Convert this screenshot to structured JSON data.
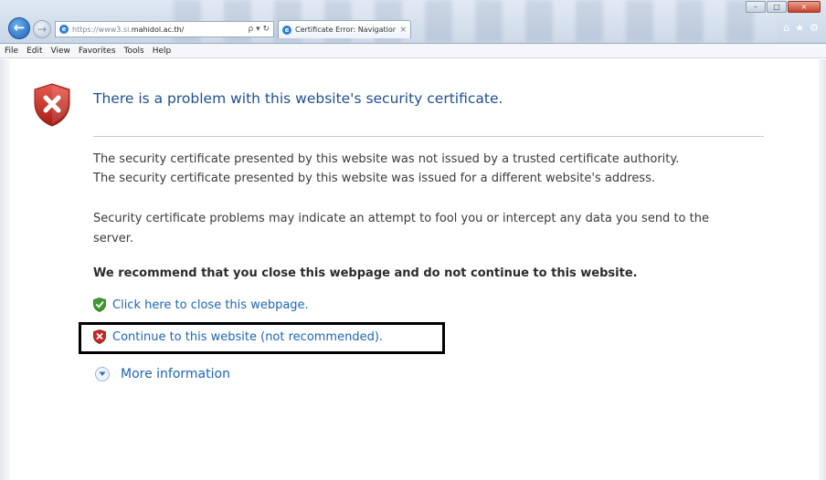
{
  "browser": {
    "address": {
      "url_prefix": "https://www3.si.",
      "url_domain": "mahidol.ac.th/",
      "tools": "ρ ▾ ↻"
    },
    "tab": {
      "title": "Certificate Error: Navigation...",
      "close": "×"
    },
    "window_buttons": {
      "minimize": "–",
      "maximize": "□",
      "close": "×"
    },
    "toolbar_icons": {
      "home": "⌂",
      "favorites": "★",
      "settings": "⚙"
    },
    "menu": [
      "File",
      "Edit",
      "View",
      "Favorites",
      "Tools",
      "Help"
    ]
  },
  "page": {
    "headline": "There is a problem with this website's security certificate.",
    "para1": "The security certificate presented by this website was not issued by a trusted certificate authority.",
    "para2": "The security certificate presented by this website was issued for a different website's address.",
    "para3": "Security certificate problems may indicate an attempt to fool you or intercept any data you send to the",
    "para4": "server.",
    "recommend": "We recommend that you close this webpage and do not continue to this website.",
    "link_close": "Click here to close this webpage.",
    "link_continue": "Continue to this website (not recommended).",
    "more_info": "More information"
  },
  "colors": {
    "headline": "#1f4f8e",
    "link": "#1e64b4",
    "shield_red": "#c62828",
    "shield_green": "#3f9a2f",
    "highlight": "#000000"
  },
  "icons": {
    "page_shield": "shield-error-icon",
    "close_link": "shield-check-icon",
    "continue_link": "shield-error-icon",
    "more_info": "chevron-down-icon"
  }
}
